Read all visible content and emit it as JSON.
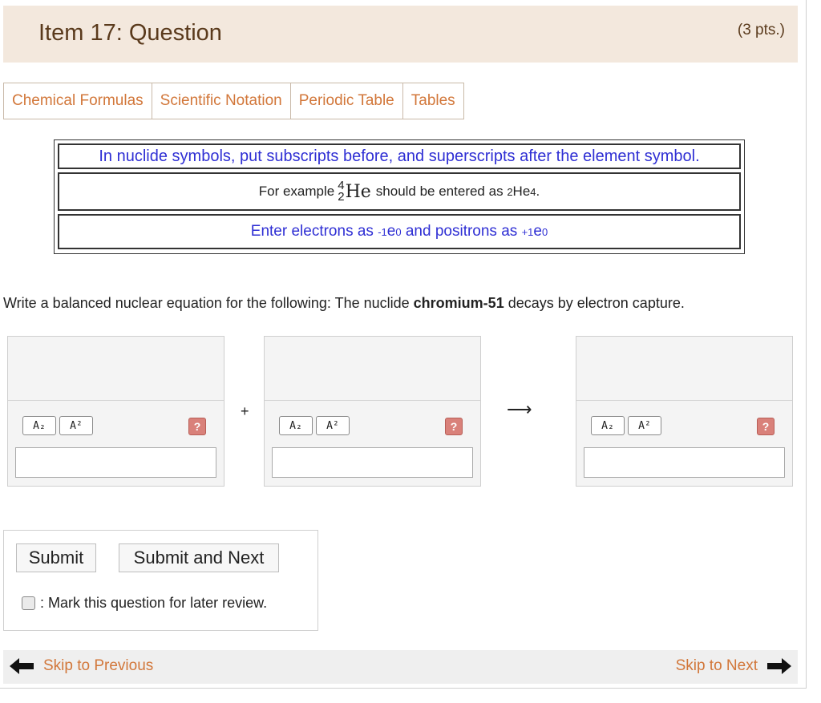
{
  "header": {
    "title": "Item 17: Question",
    "points": "(3 pts.)"
  },
  "tabs": [
    {
      "label": "Chemical Formulas"
    },
    {
      "label": "Scientific Notation"
    },
    {
      "label": "Periodic Table"
    },
    {
      "label": "Tables"
    }
  ],
  "hints": {
    "line1": "In nuclide symbols, put subscripts before, and superscripts after the element symbol.",
    "line2_prefix": "For example",
    "example_mass": "4",
    "example_atomic": "2",
    "example_symbol": "He",
    "line2_middle": "should be entered as",
    "entered_sub": "2",
    "entered_symbol": "He",
    "entered_sup": "4",
    "line2_end": ".",
    "line3_a": "Enter electrons as",
    "electron_sub": "-1",
    "electron_base": "e",
    "electron_sup": "0",
    "line3_b": "and positrons as",
    "positron_sub": "+1",
    "positron_base": "e",
    "positron_sup": "0"
  },
  "question": {
    "prefix": "Write a balanced nuclear equation for the following: The nuclide",
    "bold": "chromium-51",
    "suffix": "decays by electron capture."
  },
  "equation": {
    "plus": "+",
    "arrow": "⟶",
    "slots": [
      {
        "subscript_label": "A₂",
        "superscript_label": "A²",
        "help_label": "?",
        "value": ""
      },
      {
        "subscript_label": "A₂",
        "superscript_label": "A²",
        "help_label": "?",
        "value": ""
      },
      {
        "subscript_label": "A₂",
        "superscript_label": "A²",
        "help_label": "?",
        "value": ""
      }
    ]
  },
  "actions": {
    "submit_label": "Submit",
    "submit_next_label": "Submit and Next",
    "mark_review_label": ": Mark this question for later review."
  },
  "navigation": {
    "previous_label": "Skip to Previous",
    "next_label": "Skip to Next",
    "previous_icon": "arrow-left-icon",
    "next_icon": "arrow-right-icon"
  },
  "colors": {
    "header_bg": "#f3e8dd",
    "header_text": "#5a3a1c",
    "link": "#d2773a",
    "hint_blue": "#2f2fd4",
    "help_red": "#d9817a"
  }
}
